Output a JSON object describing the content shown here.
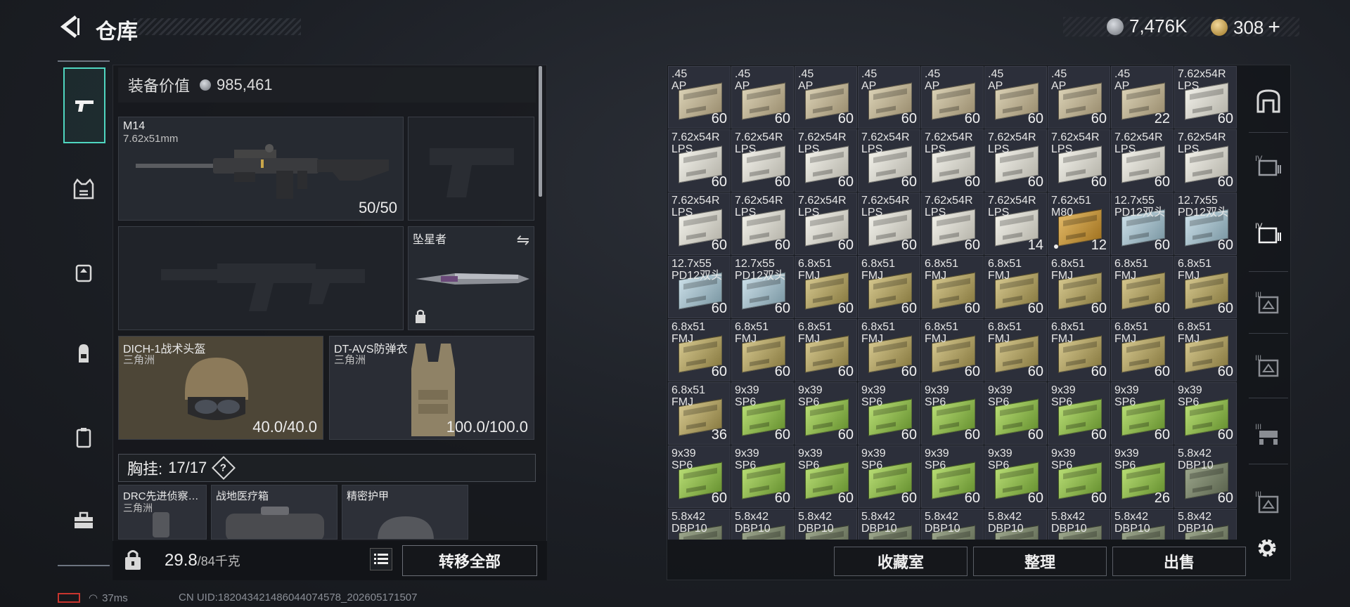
{
  "header": {
    "title": "仓库",
    "currency_silver": "7,476K",
    "currency_gold": "308",
    "currency_gold_add": "+"
  },
  "loadout": {
    "equipment_value_label": "装备价值",
    "equipment_value": "985,461",
    "primary": {
      "name": "M14",
      "caliber": "7.62x51mm",
      "ammo": "50/50"
    },
    "melee": {
      "name": "坠星者"
    },
    "helmet": {
      "name": "DICH-1战术头盔",
      "brand": "三角洲",
      "durability": "40.0/40.0"
    },
    "armor": {
      "name": "DT-AVS防弹衣",
      "brand": "三角洲",
      "durability": "100.0/100.0"
    },
    "rig": {
      "label": "胸挂:",
      "capacity": "17/17",
      "help": "?"
    },
    "rig_items": [
      {
        "name": "DRC先进侦察…",
        "brand": "三角洲"
      },
      {
        "name": "战地医疗箱",
        "brand": ""
      },
      {
        "name": "精密护甲",
        "brand": ""
      }
    ],
    "weight": "29.8",
    "weight_max": "/84千克",
    "transfer_all": "转移全部"
  },
  "status": {
    "ping": "37ms",
    "uid": "CN UID:18204342148604407457​8_202605171507"
  },
  "stash": {
    "items": [
      {
        "n1": ".45",
        "n2": "AP",
        "q": "60",
        "b": "ap"
      },
      {
        "n1": ".45",
        "n2": "AP",
        "q": "60",
        "b": "ap"
      },
      {
        "n1": ".45",
        "n2": "AP",
        "q": "60",
        "b": "ap"
      },
      {
        "n1": ".45",
        "n2": "AP",
        "q": "60",
        "b": "ap"
      },
      {
        "n1": ".45",
        "n2": "AP",
        "q": "60",
        "b": "ap"
      },
      {
        "n1": ".45",
        "n2": "AP",
        "q": "60",
        "b": "ap"
      },
      {
        "n1": ".45",
        "n2": "AP",
        "q": "60",
        "b": "ap"
      },
      {
        "n1": ".45",
        "n2": "AP",
        "q": "22",
        "b": "ap"
      },
      {
        "n1": "7.62x54R",
        "n2": "LPS",
        "q": "60",
        "b": "lps"
      },
      {
        "n1": "7.62x54R",
        "n2": "LPS",
        "q": "60",
        "b": "lps"
      },
      {
        "n1": "7.62x54R",
        "n2": "LPS",
        "q": "60",
        "b": "lps"
      },
      {
        "n1": "7.62x54R",
        "n2": "LPS",
        "q": "60",
        "b": "lps"
      },
      {
        "n1": "7.62x54R",
        "n2": "LPS",
        "q": "60",
        "b": "lps"
      },
      {
        "n1": "7.62x54R",
        "n2": "LPS",
        "q": "60",
        "b": "lps"
      },
      {
        "n1": "7.62x54R",
        "n2": "LPS",
        "q": "60",
        "b": "lps"
      },
      {
        "n1": "7.62x54R",
        "n2": "LPS",
        "q": "60",
        "b": "lps"
      },
      {
        "n1": "7.62x54R",
        "n2": "LPS",
        "q": "60",
        "b": "lps"
      },
      {
        "n1": "7.62x54R",
        "n2": "LPS",
        "q": "60",
        "b": "lps"
      },
      {
        "n1": "7.62x54R",
        "n2": "LPS",
        "q": "60",
        "b": "lps"
      },
      {
        "n1": "7.62x54R",
        "n2": "LPS",
        "q": "60",
        "b": "lps"
      },
      {
        "n1": "7.62x54R",
        "n2": "LPS",
        "q": "60",
        "b": "lps"
      },
      {
        "n1": "7.62x54R",
        "n2": "LPS",
        "q": "60",
        "b": "lps"
      },
      {
        "n1": "7.62x54R",
        "n2": "LPS",
        "q": "60",
        "b": "lps"
      },
      {
        "n1": "7.62x54R",
        "n2": "LPS",
        "q": "14",
        "b": "lps"
      },
      {
        "n1": "7.62x51",
        "n2": "M80",
        "q": "12",
        "b": "m80",
        "dot": true
      },
      {
        "n1": "12.7x55",
        "n2": "PD12双头",
        "q": "60",
        "b": "pdps"
      },
      {
        "n1": "12.7x55",
        "n2": "PD12双头",
        "q": "60",
        "b": "pdps"
      },
      {
        "n1": "12.7x55",
        "n2": "PD12双头",
        "q": "60",
        "b": "pdps"
      },
      {
        "n1": "12.7x55",
        "n2": "PD12双头",
        "q": "60",
        "b": "pdps"
      },
      {
        "n1": "6.8x51",
        "n2": "FMJ",
        "q": "60",
        "b": "fmj"
      },
      {
        "n1": "6.8x51",
        "n2": "FMJ",
        "q": "60",
        "b": "fmj"
      },
      {
        "n1": "6.8x51",
        "n2": "FMJ",
        "q": "60",
        "b": "fmj"
      },
      {
        "n1": "6.8x51",
        "n2": "FMJ",
        "q": "60",
        "b": "fmj"
      },
      {
        "n1": "6.8x51",
        "n2": "FMJ",
        "q": "60",
        "b": "fmj"
      },
      {
        "n1": "6.8x51",
        "n2": "FMJ",
        "q": "60",
        "b": "fmj"
      },
      {
        "n1": "6.8x51",
        "n2": "FMJ",
        "q": "60",
        "b": "fmj"
      },
      {
        "n1": "6.8x51",
        "n2": "FMJ",
        "q": "60",
        "b": "fmj"
      },
      {
        "n1": "6.8x51",
        "n2": "FMJ",
        "q": "60",
        "b": "fmj"
      },
      {
        "n1": "6.8x51",
        "n2": "FMJ",
        "q": "60",
        "b": "fmj"
      },
      {
        "n1": "6.8x51",
        "n2": "FMJ",
        "q": "60",
        "b": "fmj"
      },
      {
        "n1": "6.8x51",
        "n2": "FMJ",
        "q": "60",
        "b": "fmj"
      },
      {
        "n1": "6.8x51",
        "n2": "FMJ",
        "q": "60",
        "b": "fmj"
      },
      {
        "n1": "6.8x51",
        "n2": "FMJ",
        "q": "60",
        "b": "fmj"
      },
      {
        "n1": "6.8x51",
        "n2": "FMJ",
        "q": "60",
        "b": "fmj"
      },
      {
        "n1": "6.8x51",
        "n2": "FMJ",
        "q": "60",
        "b": "fmj"
      },
      {
        "n1": "6.8x51",
        "n2": "FMJ",
        "q": "36",
        "b": "fmj"
      },
      {
        "n1": "9x39",
        "n2": "SP6",
        "q": "60",
        "b": "sp6"
      },
      {
        "n1": "9x39",
        "n2": "SP6",
        "q": "60",
        "b": "sp6"
      },
      {
        "n1": "9x39",
        "n2": "SP6",
        "q": "60",
        "b": "sp6"
      },
      {
        "n1": "9x39",
        "n2": "SP6",
        "q": "60",
        "b": "sp6"
      },
      {
        "n1": "9x39",
        "n2": "SP6",
        "q": "60",
        "b": "sp6"
      },
      {
        "n1": "9x39",
        "n2": "SP6",
        "q": "60",
        "b": "sp6"
      },
      {
        "n1": "9x39",
        "n2": "SP6",
        "q": "60",
        "b": "sp6"
      },
      {
        "n1": "9x39",
        "n2": "SP6",
        "q": "60",
        "b": "sp6"
      },
      {
        "n1": "9x39",
        "n2": "SP6",
        "q": "60",
        "b": "sp6"
      },
      {
        "n1": "9x39",
        "n2": "SP6",
        "q": "60",
        "b": "sp6"
      },
      {
        "n1": "9x39",
        "n2": "SP6",
        "q": "60",
        "b": "sp6"
      },
      {
        "n1": "9x39",
        "n2": "SP6",
        "q": "60",
        "b": "sp6"
      },
      {
        "n1": "9x39",
        "n2": "SP6",
        "q": "60",
        "b": "sp6"
      },
      {
        "n1": "9x39",
        "n2": "SP6",
        "q": "60",
        "b": "sp6"
      },
      {
        "n1": "9x39",
        "n2": "SP6",
        "q": "60",
        "b": "sp6"
      },
      {
        "n1": "9x39",
        "n2": "SP6",
        "q": "26",
        "b": "sp6"
      },
      {
        "n1": "5.8x42",
        "n2": "DBP10",
        "q": "60",
        "b": "dbp"
      },
      {
        "n1": "5.8x42",
        "n2": "DBP10",
        "q": "",
        "b": "dbp"
      },
      {
        "n1": "5.8x42",
        "n2": "DBP10",
        "q": "",
        "b": "dbp"
      },
      {
        "n1": "5.8x42",
        "n2": "DBP10",
        "q": "",
        "b": "dbp"
      },
      {
        "n1": "5.8x42",
        "n2": "DBP10",
        "q": "",
        "b": "dbp"
      },
      {
        "n1": "5.8x42",
        "n2": "DBP10",
        "q": "",
        "b": "dbp"
      },
      {
        "n1": "5.8x42",
        "n2": "DBP10",
        "q": "",
        "b": "dbp"
      },
      {
        "n1": "5.8x42",
        "n2": "DBP10",
        "q": "",
        "b": "dbp"
      },
      {
        "n1": "5.8x42",
        "n2": "DBP10",
        "q": "",
        "b": "dbp"
      },
      {
        "n1": "5.8x42",
        "n2": "DBP10",
        "q": "",
        "b": "dbp"
      }
    ],
    "buttons": {
      "collection": "收藏室",
      "sort": "整理",
      "sell": "出售"
    }
  },
  "right_rail": [
    {
      "icon": "arch-icon",
      "label": ""
    },
    {
      "icon": "crate-iv-icon",
      "label": "IV"
    },
    {
      "icon": "crate-iv-active-icon",
      "label": "IV"
    },
    {
      "icon": "crate-iii-icon",
      "label": "III"
    },
    {
      "icon": "crate-iii-b-icon",
      "label": "III"
    },
    {
      "icon": "crate-iii-c-icon",
      "label": "III"
    },
    {
      "icon": "crate-iii-d-icon",
      "label": "III"
    }
  ],
  "colors": {
    "accent": "#4fd6c0",
    "battery": "#c8352e"
  }
}
